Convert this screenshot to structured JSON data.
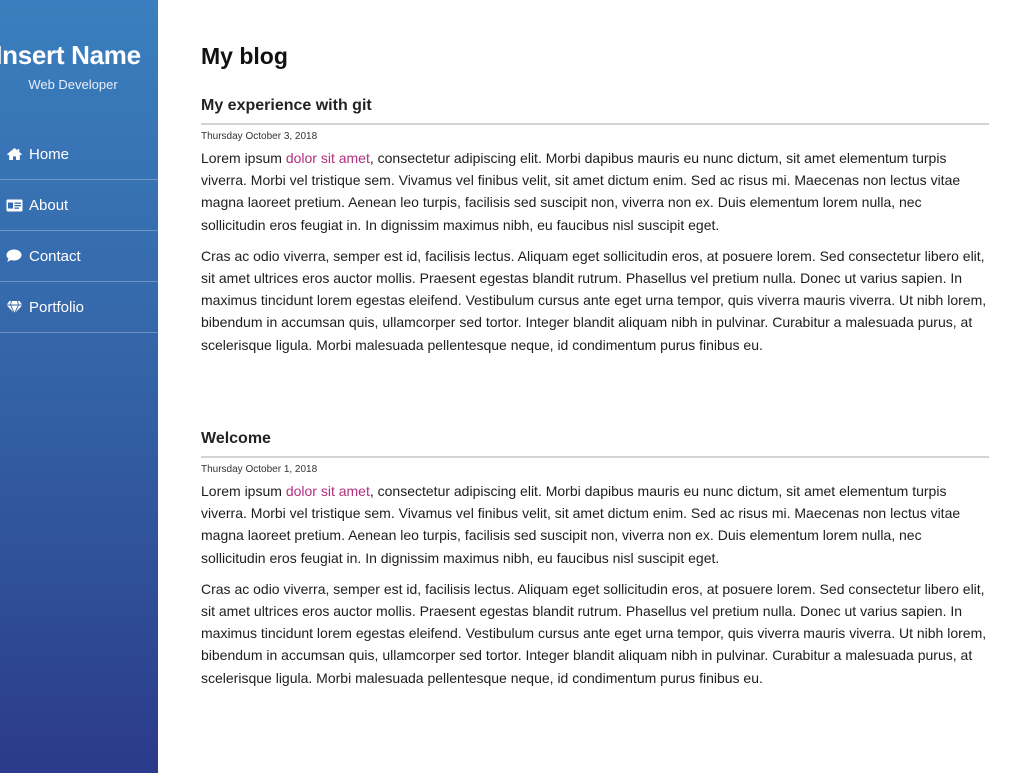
{
  "sidebar": {
    "brand_name": "Insert Name",
    "brand_role": "Web Developer",
    "nav": [
      {
        "label": "Home",
        "icon": "home-icon"
      },
      {
        "label": "About",
        "icon": "id-card-icon"
      },
      {
        "label": "Contact",
        "icon": "chat-bubble-icon"
      },
      {
        "label": "Portfolio",
        "icon": "diamond-icon"
      }
    ],
    "gradient_top": "#3a7fbf",
    "gradient_bottom": "#2b3a8a"
  },
  "main": {
    "title": "My blog",
    "posts": [
      {
        "title": "My experience with git",
        "date": "Thursday October 3, 2018",
        "p1_lead": "Lorem ipsum ",
        "p1_link": "dolor sit amet",
        "p1_rest": ", consectetur adipiscing elit. Morbi dapibus mauris eu nunc dictum, sit amet elementum turpis viverra. Morbi vel tristique sem. Vivamus vel finibus velit, sit amet dictum enim. Sed ac risus mi. Maecenas non lectus vitae magna laoreet pretium. Aenean leo turpis, facilisis sed suscipit non, viverra non ex. Duis elementum lorem nulla, nec sollicitudin eros feugiat in. In dignissim maximus nibh, eu faucibus nisl suscipit eget.",
        "p2": "Cras ac odio viverra, semper est id, facilisis lectus. Aliquam eget sollicitudin eros, at posuere lorem. Sed consectetur libero elit, sit amet ultrices eros auctor mollis. Praesent egestas blandit rutrum. Phasellus vel pretium nulla. Donec ut varius sapien. In maximus tincidunt lorem egestas eleifend. Vestibulum cursus ante eget urna tempor, quis viverra mauris viverra. Ut nibh lorem, bibendum in accumsan quis, ullamcorper sed tortor. Integer blandit aliquam nibh in pulvinar. Curabitur a malesuada purus, at scelerisque ligula. Morbi malesuada pellentesque neque, id condimentum purus finibus eu."
      },
      {
        "title": "Welcome",
        "date": "Thursday October 1, 2018",
        "p1_lead": "Lorem ipsum ",
        "p1_link": "dolor sit amet",
        "p1_rest": ", consectetur adipiscing elit. Morbi dapibus mauris eu nunc dictum, sit amet elementum turpis viverra. Morbi vel tristique sem. Vivamus vel finibus velit, sit amet dictum enim. Sed ac risus mi. Maecenas non lectus vitae magna laoreet pretium. Aenean leo turpis, facilisis sed suscipit non, viverra non ex. Duis elementum lorem nulla, nec sollicitudin eros feugiat in. In dignissim maximus nibh, eu faucibus nisl suscipit eget.",
        "p2": "Cras ac odio viverra, semper est id, facilisis lectus. Aliquam eget sollicitudin eros, at posuere lorem. Sed consectetur libero elit, sit amet ultrices eros auctor mollis. Praesent egestas blandit rutrum. Phasellus vel pretium nulla. Donec ut varius sapien. In maximus tincidunt lorem egestas eleifend. Vestibulum cursus ante eget urna tempor, quis viverra mauris viverra. Ut nibh lorem, bibendum in accumsan quis, ullamcorper sed tortor. Integer blandit aliquam nibh in pulvinar. Curabitur a malesuada purus, at scelerisque ligula. Morbi malesuada pellentesque neque, id condimentum purus finibus eu."
      }
    ]
  },
  "colors": {
    "link_accent": "#b0307f",
    "divider": "#d4d4d4"
  }
}
